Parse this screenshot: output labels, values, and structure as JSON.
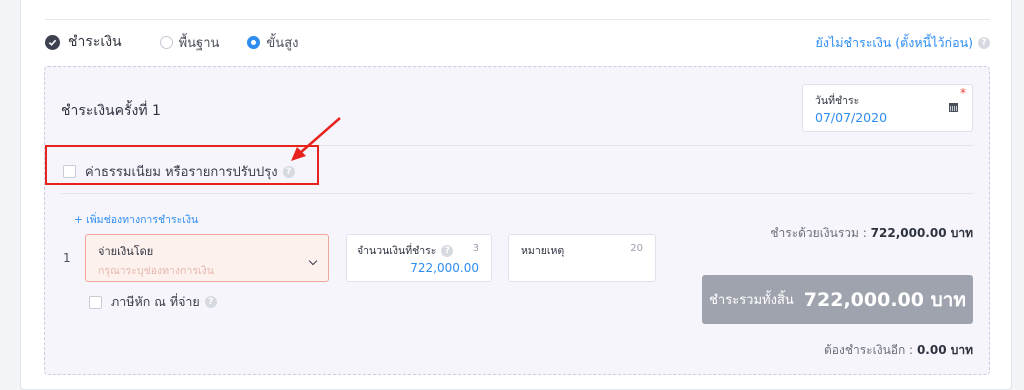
{
  "payment": {
    "title": "ชำระเงิน",
    "options": [
      {
        "label": "พื้นฐาน",
        "selected": false
      },
      {
        "label": "ขั้นสูง",
        "selected": true
      }
    ],
    "unpaid_link": "ยังไม่ชำระเงิน (ตั้งหนี้ไว้ก่อน)"
  },
  "installment": {
    "title": "ชำระเงินครั้งที่ 1",
    "date_label": "วันที่ชำระ",
    "date_value": "07/07/2020",
    "fee_label": "ค่าธรรมเนียม หรือรายการปรับปรุง",
    "add_channel": "+ เพิ่มช่องทางการชำระเงิน",
    "row_number": "1",
    "method_label": "จ่ายเงินโดย",
    "method_placeholder": "กรุณาระบุช่องทางการเงิน",
    "amount_label": "จำนวนเงินที่ชำระ",
    "amount_count": "3",
    "amount_value": "722,000.00",
    "note_label": "หมายเหตุ",
    "note_count": "20",
    "wht_label": "ภาษีหัก ณ ที่จ่าย"
  },
  "summary": {
    "cash_total_label": "ชำระด้วยเงินรวม :",
    "cash_total_value": "722,000.00 บาท",
    "grand_total_label": "ชำระรวมทั้งสิ้น",
    "grand_total_value": "722,000.00 บาท",
    "remaining_label": "ต้องชำระเงินอีก :",
    "remaining_value": "0.00 บาท"
  },
  "colors": {
    "accent": "#2f8df2",
    "highlight": "#e8231e",
    "button": "#9fa3ae"
  },
  "icons": [
    "check-circle-icon",
    "help-icon",
    "calendar-icon",
    "chevron-down-icon",
    "arrow-annotation-icon"
  ]
}
